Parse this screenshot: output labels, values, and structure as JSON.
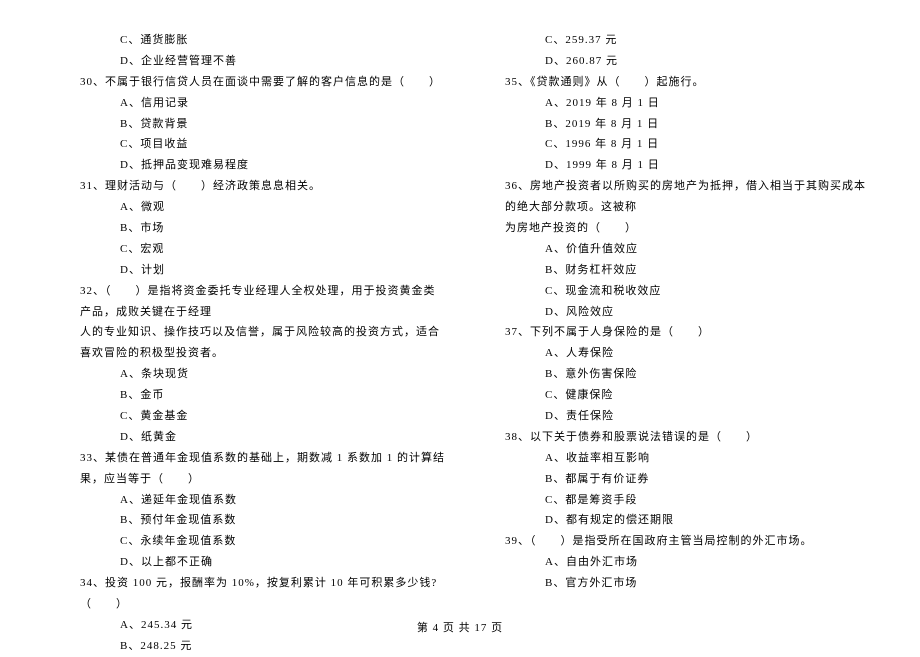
{
  "left_column": {
    "q29": {
      "optC": "C、通货膨胀",
      "optD": "D、企业经营管理不善"
    },
    "q30": {
      "text": "30、不属于银行信贷人员在面谈中需要了解的客户信息的是（　　）",
      "optA": "A、信用记录",
      "optB": "B、贷款背景",
      "optC": "C、项目收益",
      "optD": "D、抵押品变现难易程度"
    },
    "q31": {
      "text": "31、理财活动与（　　）经济政策息息相关。",
      "optA": "A、微观",
      "optB": "B、市场",
      "optC": "C、宏观",
      "optD": "D、计划"
    },
    "q32": {
      "text": "32、（　　）是指将资金委托专业经理人全权处理，用于投资黄金类产品，成败关键在于经理",
      "cont": "人的专业知识、操作技巧以及信誉，属于风险较高的投资方式，适合喜欢冒险的积极型投资者。",
      "optA": "A、条块现货",
      "optB": "B、金币",
      "optC": "C、黄金基金",
      "optD": "D、纸黄金"
    },
    "q33": {
      "text": "33、某债在普通年金现值系数的基础上，期数减 1 系数加 1 的计算结果，应当等于（　　）",
      "optA": "A、递延年金现值系数",
      "optB": "B、预付年金现值系数",
      "optC": "C、永续年金现值系数",
      "optD": "D、以上都不正确"
    },
    "q34": {
      "text": "34、投资 100 元，报酬率为 10%，按复利累计 10 年可积累多少钱?（　　）",
      "optA": "A、245.34 元",
      "optB": "B、248.25 元"
    }
  },
  "right_column": {
    "q34": {
      "optC": "C、259.37 元",
      "optD": "D、260.87 元"
    },
    "q35": {
      "text": "35、《贷款通则》从（　　）起施行。",
      "optA": "A、2019 年 8 月 1 日",
      "optB": "B、2019 年 8 月 1 日",
      "optC": "C、1996 年 8 月 1 日",
      "optD": "D、1999 年 8 月 1 日"
    },
    "q36": {
      "text": "36、房地产投资者以所购买的房地产为抵押，借入相当于其购买成本的绝大部分款项。这被称",
      "cont": "为房地产投资的（　　）",
      "optA": "A、价值升值效应",
      "optB": "B、财务杠杆效应",
      "optC": "C、现金流和税收效应",
      "optD": "D、风险效应"
    },
    "q37": {
      "text": "37、下列不属于人身保险的是（　　）",
      "optA": "A、人寿保险",
      "optB": "B、意外伤害保险",
      "optC": "C、健康保险",
      "optD": "D、责任保险"
    },
    "q38": {
      "text": "38、以下关于债券和股票说法错误的是（　　）",
      "optA": "A、收益率相互影响",
      "optB": "B、都属于有价证券",
      "optC": "C、都是筹资手段",
      "optD": "D、都有规定的偿还期限"
    },
    "q39": {
      "text": "39、（　　）是指受所在国政府主管当局控制的外汇市场。",
      "optA": "A、自由外汇市场",
      "optB": "B、官方外汇市场"
    }
  },
  "footer": "第 4 页 共 17 页"
}
